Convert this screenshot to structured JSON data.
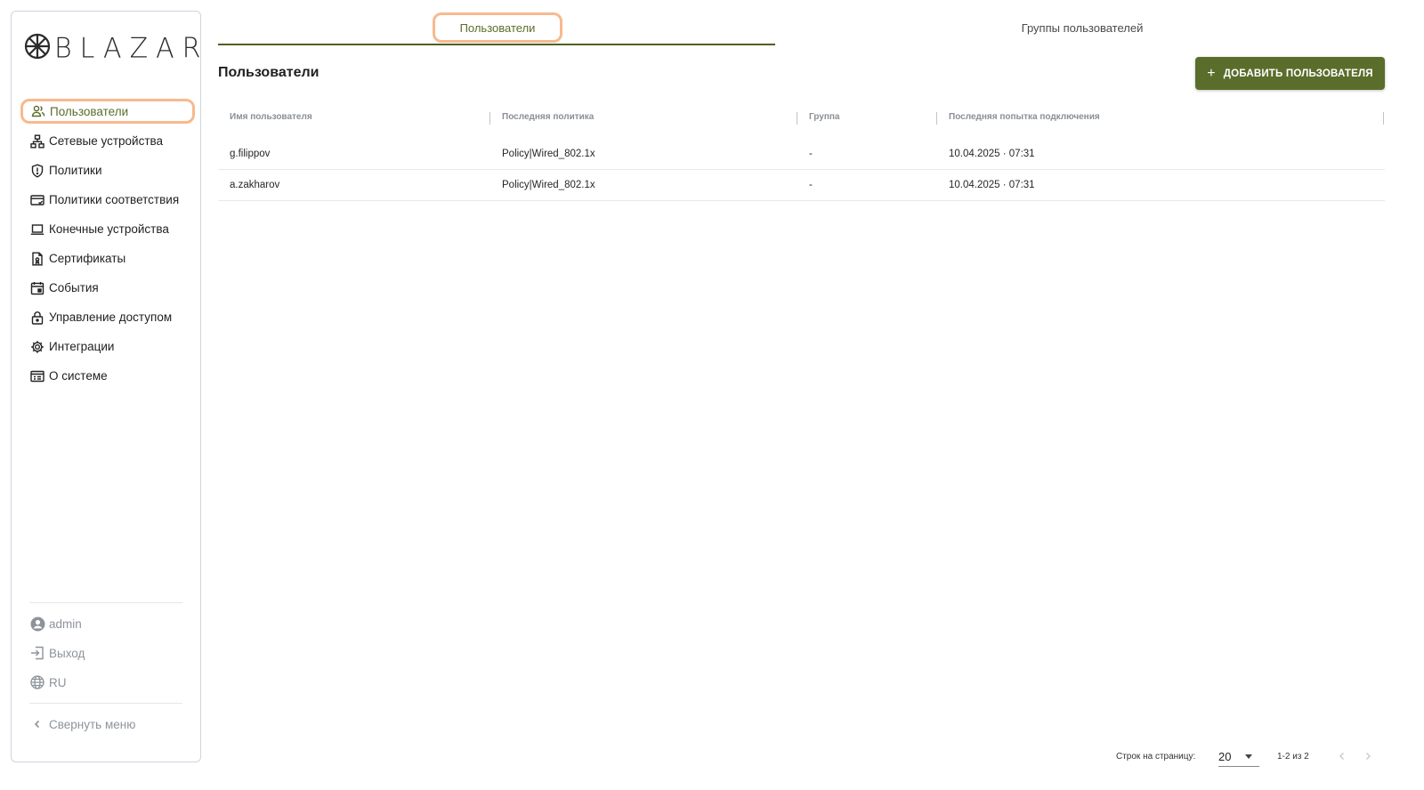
{
  "brand": {
    "logo_text": "BLAZAR",
    "accent": "#5a6d2a",
    "highlight": "#f8b98d"
  },
  "sidebar": {
    "items": [
      {
        "label": "Пользователи",
        "icon": "users-icon",
        "active": true
      },
      {
        "label": "Сетевые устройства",
        "icon": "network-icon"
      },
      {
        "label": "Политики",
        "icon": "shield-icon"
      },
      {
        "label": "Политики соответствия",
        "icon": "card-check-icon"
      },
      {
        "label": "Конечные устройства",
        "icon": "laptop-icon"
      },
      {
        "label": "Сертификаты",
        "icon": "certificate-icon"
      },
      {
        "label": "События",
        "icon": "calendar-icon"
      },
      {
        "label": "Управление доступом",
        "icon": "lock-icon"
      },
      {
        "label": "Интеграции",
        "icon": "gear-icon"
      },
      {
        "label": "О системе",
        "icon": "info-window-icon"
      }
    ],
    "user": "admin",
    "logout": "Выход",
    "language": "RU",
    "collapse": "Свернуть меню"
  },
  "tabs": [
    {
      "label": "Пользователи",
      "active": true
    },
    {
      "label": "Группы пользователей",
      "active": false
    }
  ],
  "page": {
    "title": "Пользователи",
    "add_button": "ДОБАВИТЬ ПОЛЬЗОВАТЕЛЯ"
  },
  "table": {
    "columns": [
      "Имя пользователя",
      "Последняя политика",
      "Группа",
      "Последняя попытка подключения"
    ],
    "rows": [
      [
        "g.filippov",
        "Policy|Wired_802.1x",
        "-",
        "10.04.2025 · 07:31"
      ],
      [
        "a.zakharov",
        "Policy|Wired_802.1x",
        "-",
        "10.04.2025 · 07:31"
      ]
    ]
  },
  "pagination": {
    "rows_per_page_label": "Строк на страницу:",
    "rows_per_page": "20",
    "range": "1-2 из 2"
  }
}
